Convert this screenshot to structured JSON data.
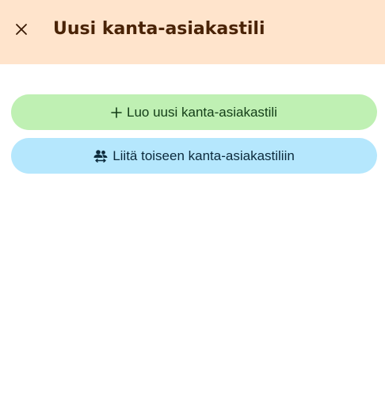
{
  "header": {
    "title": "Uusi kanta-asiakastili",
    "close_icon": "close-icon"
  },
  "actions": {
    "create": {
      "label": "Luo uusi kanta-asiakastili",
      "icon": "plus-icon",
      "color": "#bff0b3"
    },
    "join": {
      "label": "Liitä toiseen kanta-asiakastiliin",
      "icon": "group-link-icon",
      "color": "#b5e7fd"
    }
  },
  "colors": {
    "header_bg": "#ffe4cc",
    "title": "#4a2306"
  }
}
